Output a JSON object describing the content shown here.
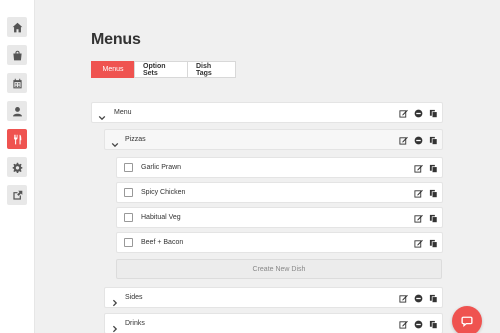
{
  "sidebar": {
    "items": [
      {
        "icon": "home-icon"
      },
      {
        "icon": "shopping-bag-icon"
      },
      {
        "icon": "calendar-icon"
      },
      {
        "icon": "user-icon"
      },
      {
        "icon": "cutlery-icon",
        "active": true
      },
      {
        "icon": "gear-icon"
      },
      {
        "icon": "external-link-icon"
      }
    ]
  },
  "page": {
    "title": "Menus"
  },
  "tabs": [
    {
      "label": "Menus",
      "active": true
    },
    {
      "label": "Option Sets"
    },
    {
      "label": "Dish Tags"
    }
  ],
  "menu": {
    "label": "Menu",
    "categories": [
      {
        "label": "Pizzas",
        "expanded": true,
        "dishes": [
          "Garlic Prawn",
          "Spicy Chicken",
          "Habitual Veg",
          "Beef + Bacon"
        ],
        "create_label": "Create New Dish"
      },
      {
        "label": "Sides",
        "expanded": false
      },
      {
        "label": "Drinks",
        "expanded": false
      }
    ]
  },
  "colors": {
    "accent": "#ef5350"
  }
}
